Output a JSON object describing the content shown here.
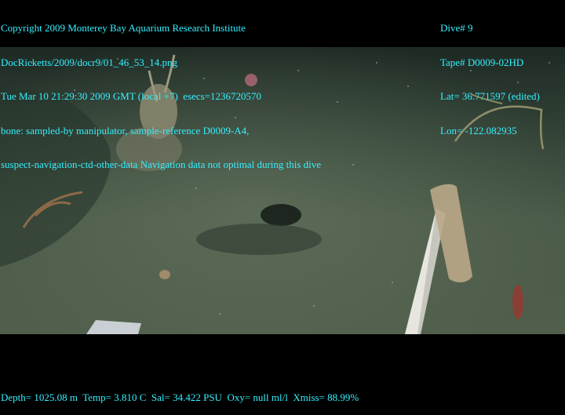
{
  "overlay_left": {
    "copyright": "Copyright 2009 Monterey Bay Aquarium Research Institute",
    "file": "DocRicketts/2009/docr9/01_46_53_14.png",
    "datetime": "Tue Mar 10 21:29:30 2009 GMT (local +7)  esecs=1236720570",
    "annotation": "bone: sampled-by manipulator, sample-reference D0009-A4,",
    "note": "suspect-navigation-ctd-other-data Navigation data not optimal during this dive"
  },
  "overlay_right": {
    "dive": "Dive# 9",
    "tape": "Tape# D0009-02HD",
    "lat": "Lat= 36.771597 (edited)",
    "lon": "Lon= -122.082935"
  },
  "overlay_bottom": {
    "sensors": "Depth= 1025.08 m  Temp= 3.810 C  Sal= 34.422 PSU  Oxy= null ml/l  Xmiss= 88.99%"
  },
  "colors": {
    "overlay_text": "#35f0ff",
    "background": "#000000"
  }
}
